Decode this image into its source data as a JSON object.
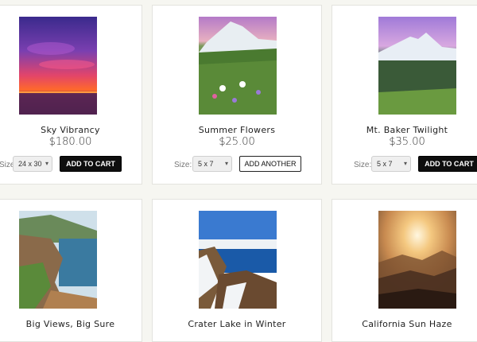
{
  "products": [
    {
      "title": "Sky Vibrancy",
      "price": "$180.00",
      "size_label": "Size:",
      "size_value": "24 x 30",
      "button": "ADD TO CART",
      "photo_icon": "sunset-sky-photo"
    },
    {
      "title": "Summer Flowers",
      "price": "$25.00",
      "size_label": "Size:",
      "size_value": "5 x 7",
      "button": "ADD ANOTHER",
      "photo_icon": "mountain-wildflowers-photo"
    },
    {
      "title": "Mt. Baker Twilight",
      "price": "$35.00",
      "size_label": "Size:",
      "size_value": "5 x 7",
      "button": "ADD TO CART",
      "photo_icon": "mountain-twilight-photo"
    },
    {
      "title": "Big Views, Big Sure",
      "photo_icon": "coastline-photo"
    },
    {
      "title": "Crater Lake in Winter",
      "photo_icon": "crater-lake-photo"
    },
    {
      "title": "California Sun Haze",
      "photo_icon": "sun-haze-photo"
    }
  ],
  "colors": {
    "page_bg": "#f6f6f1",
    "button_dark": "#0e0e0e"
  }
}
